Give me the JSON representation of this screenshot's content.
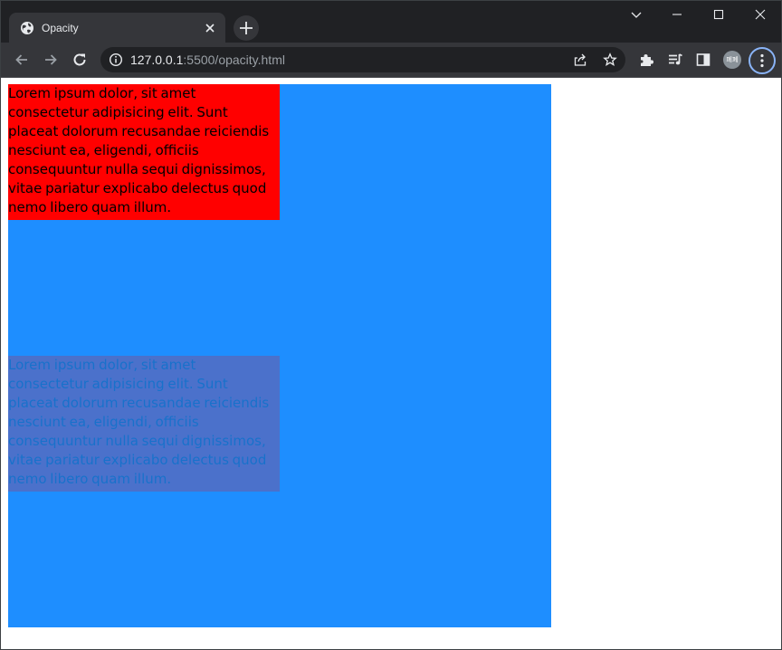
{
  "browser": {
    "tab": {
      "title": "Opacity",
      "favicon": "globe-icon",
      "close_icon": "close-icon"
    },
    "new_tab_icon": "plus-icon",
    "window_controls": [
      "chevron-down-icon",
      "minimize-icon",
      "maximize-icon",
      "close-icon"
    ],
    "toolbar": {
      "back_icon": "arrow-left-icon",
      "forward_icon": "arrow-right-icon",
      "reload_icon": "reload-icon",
      "site_info_icon": "info-icon",
      "url_host": "127.0.0.1",
      "url_path": ":5500/opacity.html",
      "share_icon": "share-icon",
      "bookmark_icon": "star-icon",
      "extensions_icon": "puzzle-icon",
      "media_icon": "media-queue-icon",
      "side_panel_icon": "side-panel-icon",
      "profile_label": "폐폐",
      "menu_icon": "kebab-menu-icon"
    },
    "colors": {
      "frame": "#202124",
      "toolbar": "#35363a",
      "accent": "#8ab4f8"
    }
  },
  "page": {
    "outer_box": {
      "color": "#1e8eff"
    },
    "boxes": [
      {
        "text": "Lorem ipsum dolor, sit amet consectetur adipisicing elit. Sunt placeat dolorum recusandae reiciendis nesciunt ea, eligendi, officiis consequuntur nulla sequi dignissimos, vitae pariatur explicabo delectus quod nemo libero quam illum.",
        "color": "#ff0000",
        "opacity": 1
      },
      {
        "text": "Lorem ipsum dolor, sit amet consectetur adipisicing elit. Sunt placeat dolorum recusandae reiciendis nesciunt ea, eligendi, officiis consequuntur nulla sequi dignissimos, vitae pariatur explicabo delectus quod nemo libero quam illum.",
        "color": "#ff0000",
        "opacity": 0.2
      }
    ]
  }
}
